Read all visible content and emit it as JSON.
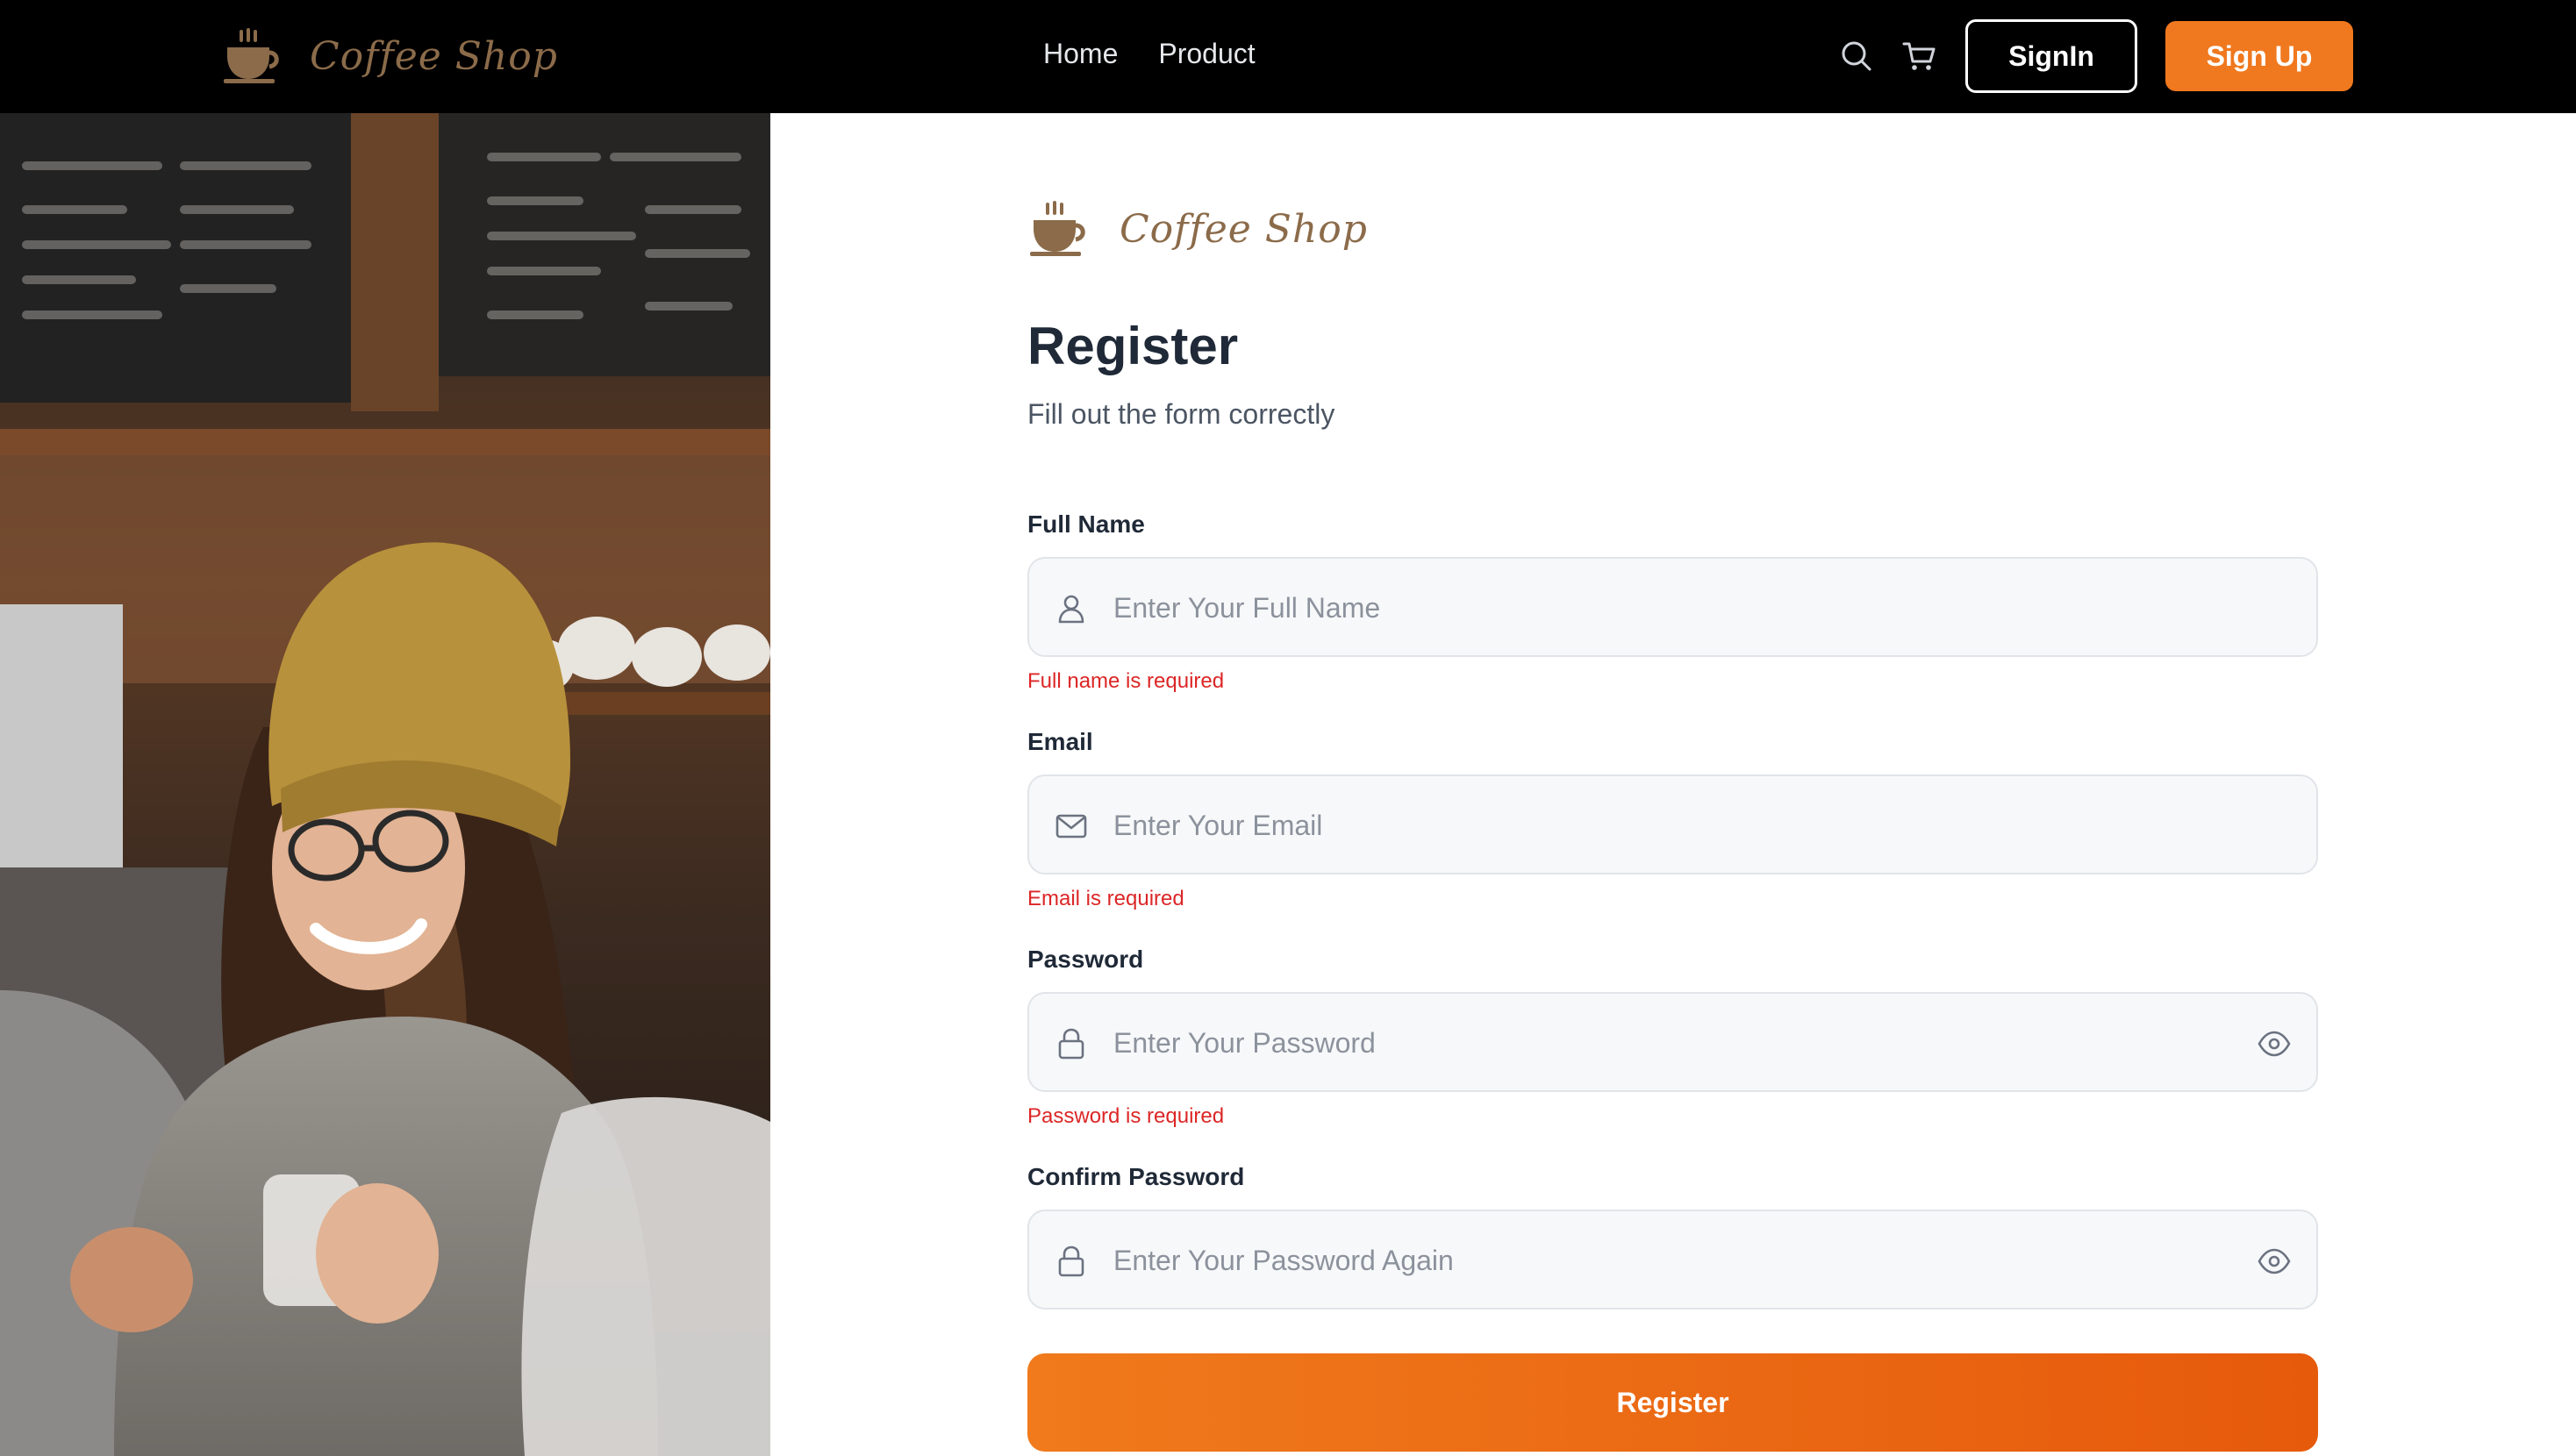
{
  "brand": {
    "name": "Coffee Shop",
    "accent_color": "#f0781e",
    "logo_color": "#8b6b4a"
  },
  "navbar": {
    "links": [
      {
        "label": "Home"
      },
      {
        "label": "Product"
      }
    ],
    "icons": [
      "search-icon",
      "cart-icon"
    ],
    "signin_label": "SignIn",
    "signup_label": "Sign Up"
  },
  "hero": {
    "image": "barista-woman-in-mustard-beanie-photo"
  },
  "form": {
    "title": "Register",
    "subtitle": "Fill out the form correctly",
    "fields": [
      {
        "label": "Full Name",
        "placeholder": "Enter Your Full Name",
        "value": "",
        "icon": "user-icon",
        "error": "Full name is required"
      },
      {
        "label": "Email",
        "placeholder": "Enter Your Email",
        "value": "",
        "icon": "mail-icon",
        "error": "Email is required"
      },
      {
        "label": "Password",
        "placeholder": "Enter Your Password",
        "value": "",
        "icon": "lock-icon",
        "error": "Password is required"
      },
      {
        "label": "Confirm Password",
        "placeholder": "Enter Your Password Again",
        "value": "",
        "icon": "lock-icon"
      }
    ],
    "submit_label": "Register"
  }
}
